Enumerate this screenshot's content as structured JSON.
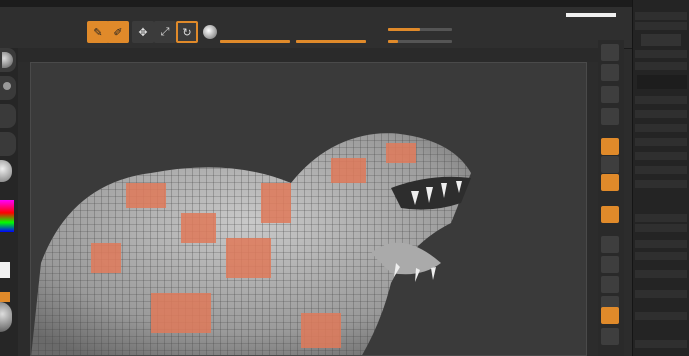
{
  "menubar": {
    "items": [
      "",
      "",
      "",
      "",
      "",
      "",
      "",
      "",
      "",
      "",
      "",
      "",
      "",
      "",
      "",
      ""
    ],
    "window_controls": "— ▢ ✕"
  },
  "toolbar": {
    "lightbox_label": "",
    "live_boolean_label": "",
    "edit_icon": "edit-icon",
    "draw_icon": "draw-icon",
    "move_icon": "move-icon",
    "scale_icon": "scale-icon",
    "rotate_icon": "rotate-icon",
    "mrgb_label": "",
    "rgb_label": "",
    "m_label": "",
    "zadd_label": "",
    "zsub_label": "",
    "rgb_intensity_label": "",
    "z_intensity_label": "",
    "focal_shift_label": "",
    "draw_size_label": "",
    "dynamic_label": "",
    "active_points_label": "",
    "total_points_label": ""
  },
  "colors": {
    "accent": "#e08a2a",
    "bg_dark": "#2c2c2c",
    "canvas": "#3a3a3a",
    "polypaint": "#e07a5a"
  },
  "right_panel": {
    "title": "",
    "items": [
      "",
      "",
      "",
      "",
      "",
      "",
      "",
      "",
      "",
      "",
      "",
      "",
      "",
      "",
      "",
      "",
      "",
      "",
      ""
    ]
  }
}
